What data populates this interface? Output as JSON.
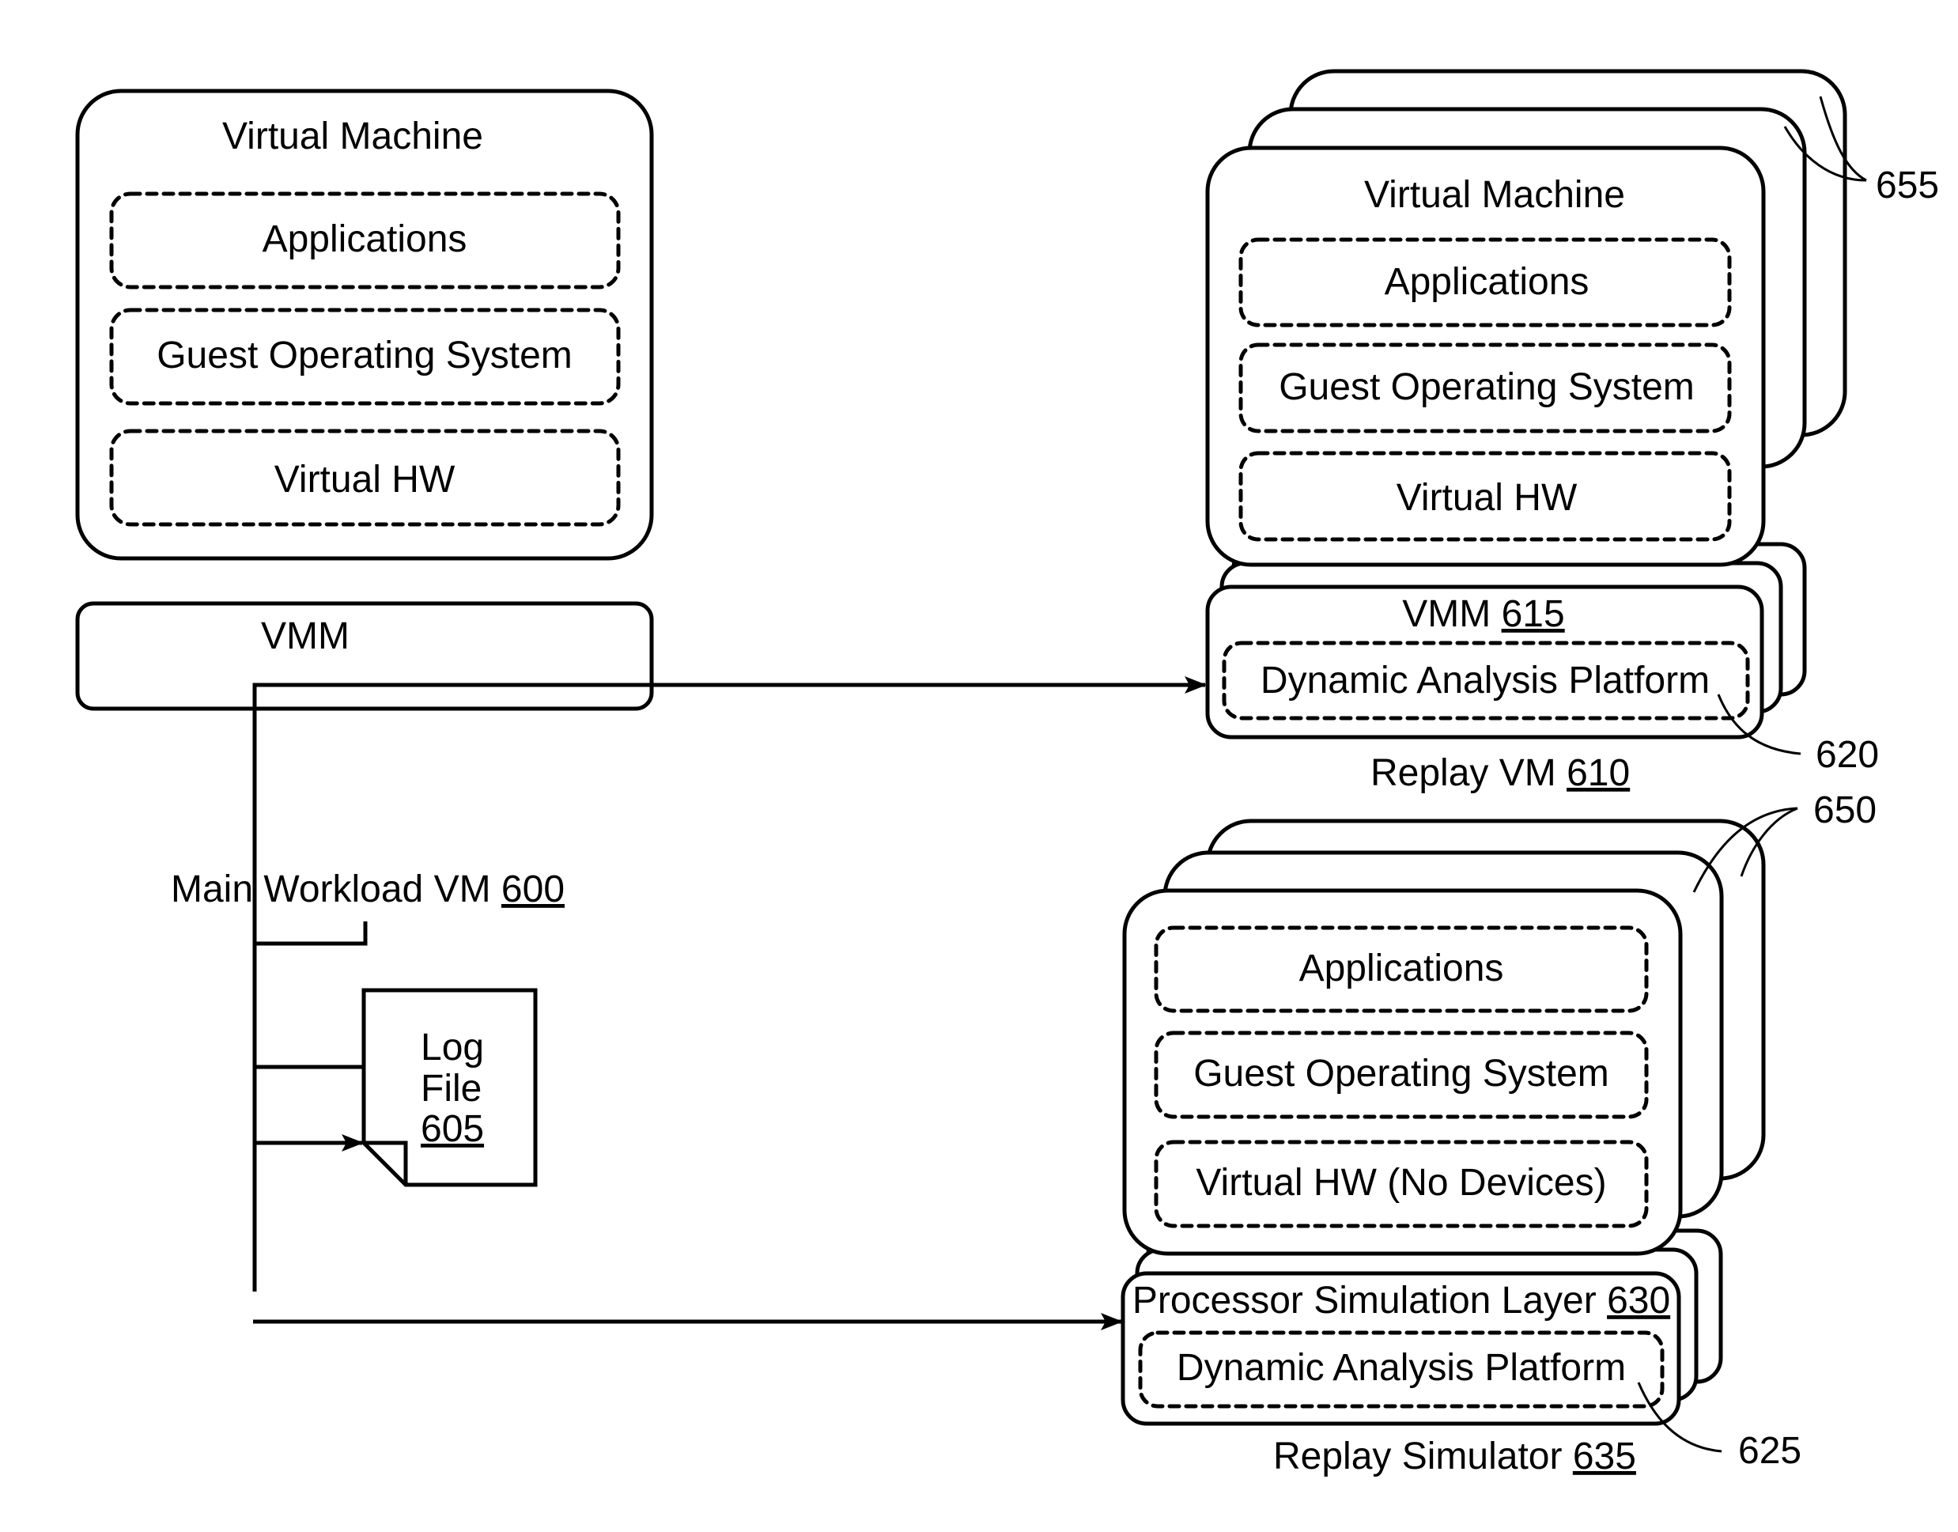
{
  "figure": {
    "main_workload_vm": {
      "virtual_machine": {
        "title": "Virtual Machine",
        "layers": [
          "Applications",
          "Guest Operating System",
          "Virtual HW"
        ]
      },
      "vmm_label": "VMM",
      "caption_text": "Main Workload VM ",
      "caption_ref": "600"
    },
    "log_file": {
      "line1": "Log",
      "line2": "File",
      "ref": "605"
    },
    "replay_vm": {
      "virtual_machine": {
        "title": "Virtual Machine",
        "layers": [
          "Applications",
          "Guest Operating System",
          "Virtual HW"
        ]
      },
      "vmm_label": "VMM ",
      "vmm_ref": "615",
      "dap_label": "Dynamic Analysis Platform",
      "caption_text": "Replay VM ",
      "caption_ref": "610",
      "stack_ref": "655",
      "dap_ref": "620"
    },
    "replay_simulator": {
      "virtual_machine": {
        "layers": [
          "Applications",
          "Guest Operating System",
          "Virtual HW (No Devices)"
        ]
      },
      "psl_label": "Processor Simulation Layer ",
      "psl_ref": "630",
      "dap_label": "Dynamic Analysis Platform",
      "caption_text": "Replay Simulator ",
      "caption_ref": "635",
      "stack_ref": "650",
      "dap_ref": "625"
    }
  }
}
